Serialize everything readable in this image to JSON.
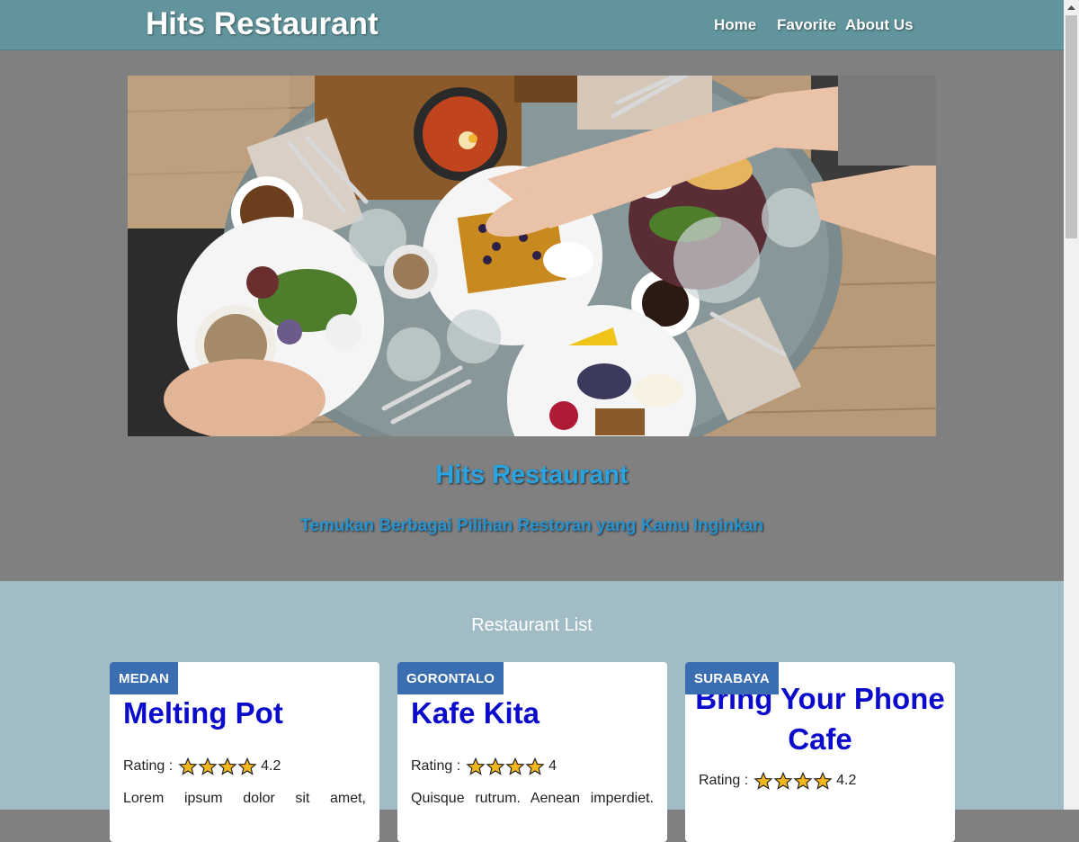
{
  "header": {
    "brand": "Hits Restaurant",
    "nav": [
      "Home",
      "Favorite",
      "About Us"
    ]
  },
  "hero": {
    "title": "Hits Restaurant",
    "subtitle": "Temukan Berbagai Pilihan Restoran yang Kamu Inginkan"
  },
  "list": {
    "title": "Restaurant List",
    "rating_label": "Rating :",
    "restaurants": [
      {
        "city": "MEDAN",
        "name": "Melting Pot",
        "rating": "4.2",
        "description": "Lorem ipsum dolor sit amet,"
      },
      {
        "city": "GORONTALO",
        "name": "Kafe Kita",
        "rating": "4",
        "description": "Quisque rutrum. Aenean imperdiet."
      },
      {
        "city": "SURABAYA",
        "name": "Bring Your Phone Cafe",
        "rating": "4.2",
        "description": ""
      }
    ]
  },
  "colors": {
    "header_bg": "#61949c",
    "hero_bg": "#808080",
    "hero_text": "#2aa3de",
    "list_bg": "#a1bcc5",
    "city_badge": "#3a6eb0",
    "card_title": "#0b0bcc"
  }
}
